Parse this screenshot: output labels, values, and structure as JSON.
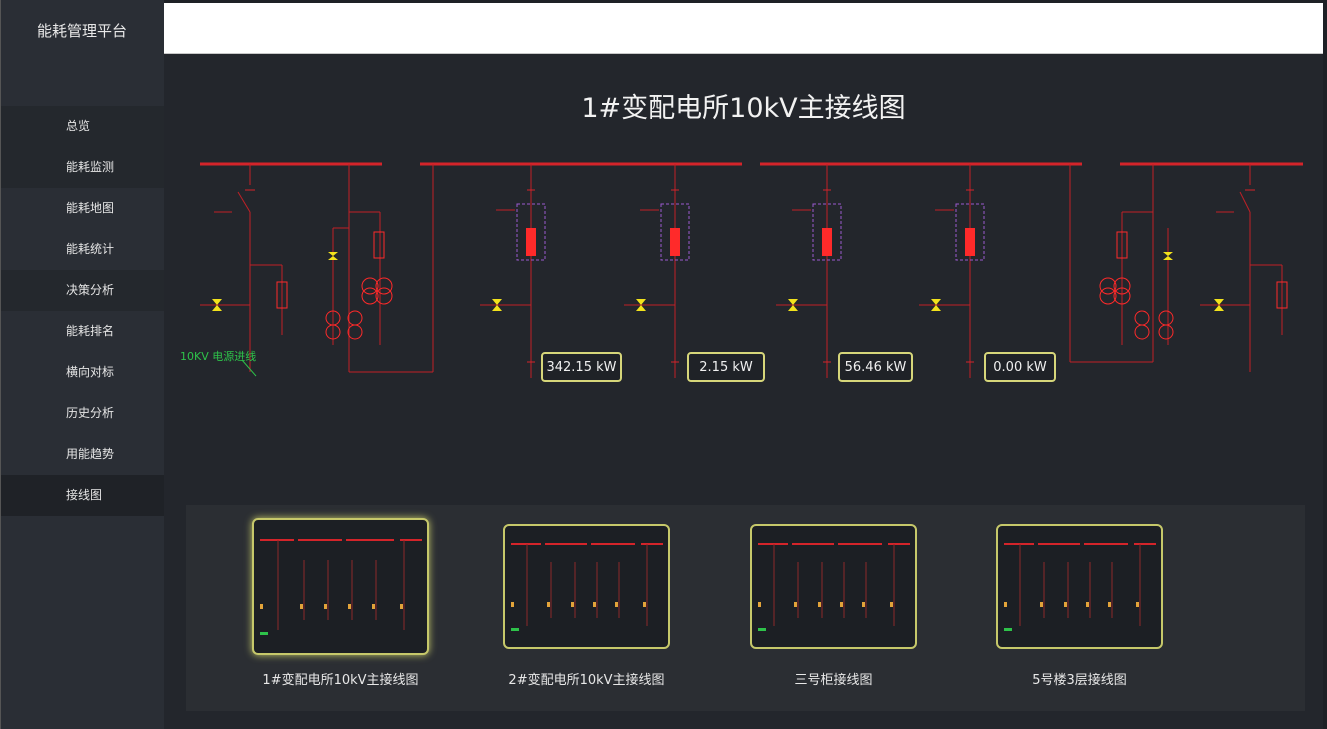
{
  "app": {
    "title": "能耗管理平台"
  },
  "nav": {
    "items": [
      {
        "label": "总览"
      },
      {
        "label": "能耗监测"
      },
      {
        "label": "能耗地图"
      },
      {
        "label": "能耗统计"
      },
      {
        "label": "决策分析"
      },
      {
        "label": "能耗排名"
      },
      {
        "label": "横向对标"
      },
      {
        "label": "历史分析"
      },
      {
        "label": "用能趋势"
      },
      {
        "label": "接线图"
      }
    ]
  },
  "diagram": {
    "title": "1#变配电所10kV主接线图",
    "incoming_label": "10KV 电源进线",
    "meters": [
      "342.15 kW",
      "2.15 kW",
      "56.46 kW",
      "0.00 kW"
    ]
  },
  "thumbnails": [
    {
      "caption": "1#变配电所10kV主接线图"
    },
    {
      "caption": "2#变配电所10kV主接线图"
    },
    {
      "caption": "三号柜接线图"
    },
    {
      "caption": "5号楼3层接线图"
    }
  ],
  "colors": {
    "busbar": "#d4242a",
    "breaker_fill": "#ff2a2a",
    "dashed_outline": "#9b59d0",
    "yellow_symbol": "#f2e21c",
    "meter_border": "#d6d67a",
    "incoming_label": "#2ec24a"
  }
}
